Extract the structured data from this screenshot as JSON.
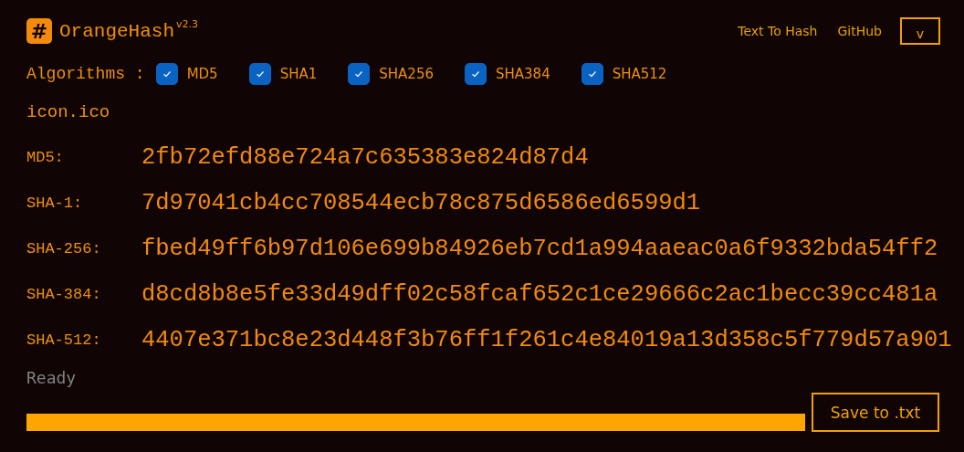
{
  "header": {
    "logo_glyph": "#",
    "app_name": "OrangeHash",
    "version": "v2.3",
    "nav_links": [
      "Text To Hash",
      "GitHub"
    ],
    "menu_toggle": "v"
  },
  "algorithms": {
    "label": "Algorithms :",
    "items": [
      {
        "label": "MD5",
        "checked": true
      },
      {
        "label": "SHA1",
        "checked": true
      },
      {
        "label": "SHA256",
        "checked": true
      },
      {
        "label": "SHA384",
        "checked": true
      },
      {
        "label": "SHA512",
        "checked": true
      }
    ]
  },
  "file_name": "icon.ico",
  "hashes": [
    {
      "label": "MD5:",
      "value": "2fb72efd88e724a7c635383e824d87d4"
    },
    {
      "label": "SHA-1:",
      "value": "7d97041cb4cc708544ecb78c875d6586ed6599d1"
    },
    {
      "label": "SHA-256:",
      "value": "fbed49ff6b97d106e699b84926eb7cd1a994aaeac0a6f9332bda54ff2"
    },
    {
      "label": "SHA-384:",
      "value": "d8cd8b8e5fe33d49dff02c58fcaf652c1ce29666c2ac1becc39cc481a"
    },
    {
      "label": "SHA-512:",
      "value": "4407e371bc8e23d448f3b76ff1f261c4e84019a13d358c5f779d57a901"
    }
  ],
  "status": "Ready",
  "save_button": "Save to .txt"
}
